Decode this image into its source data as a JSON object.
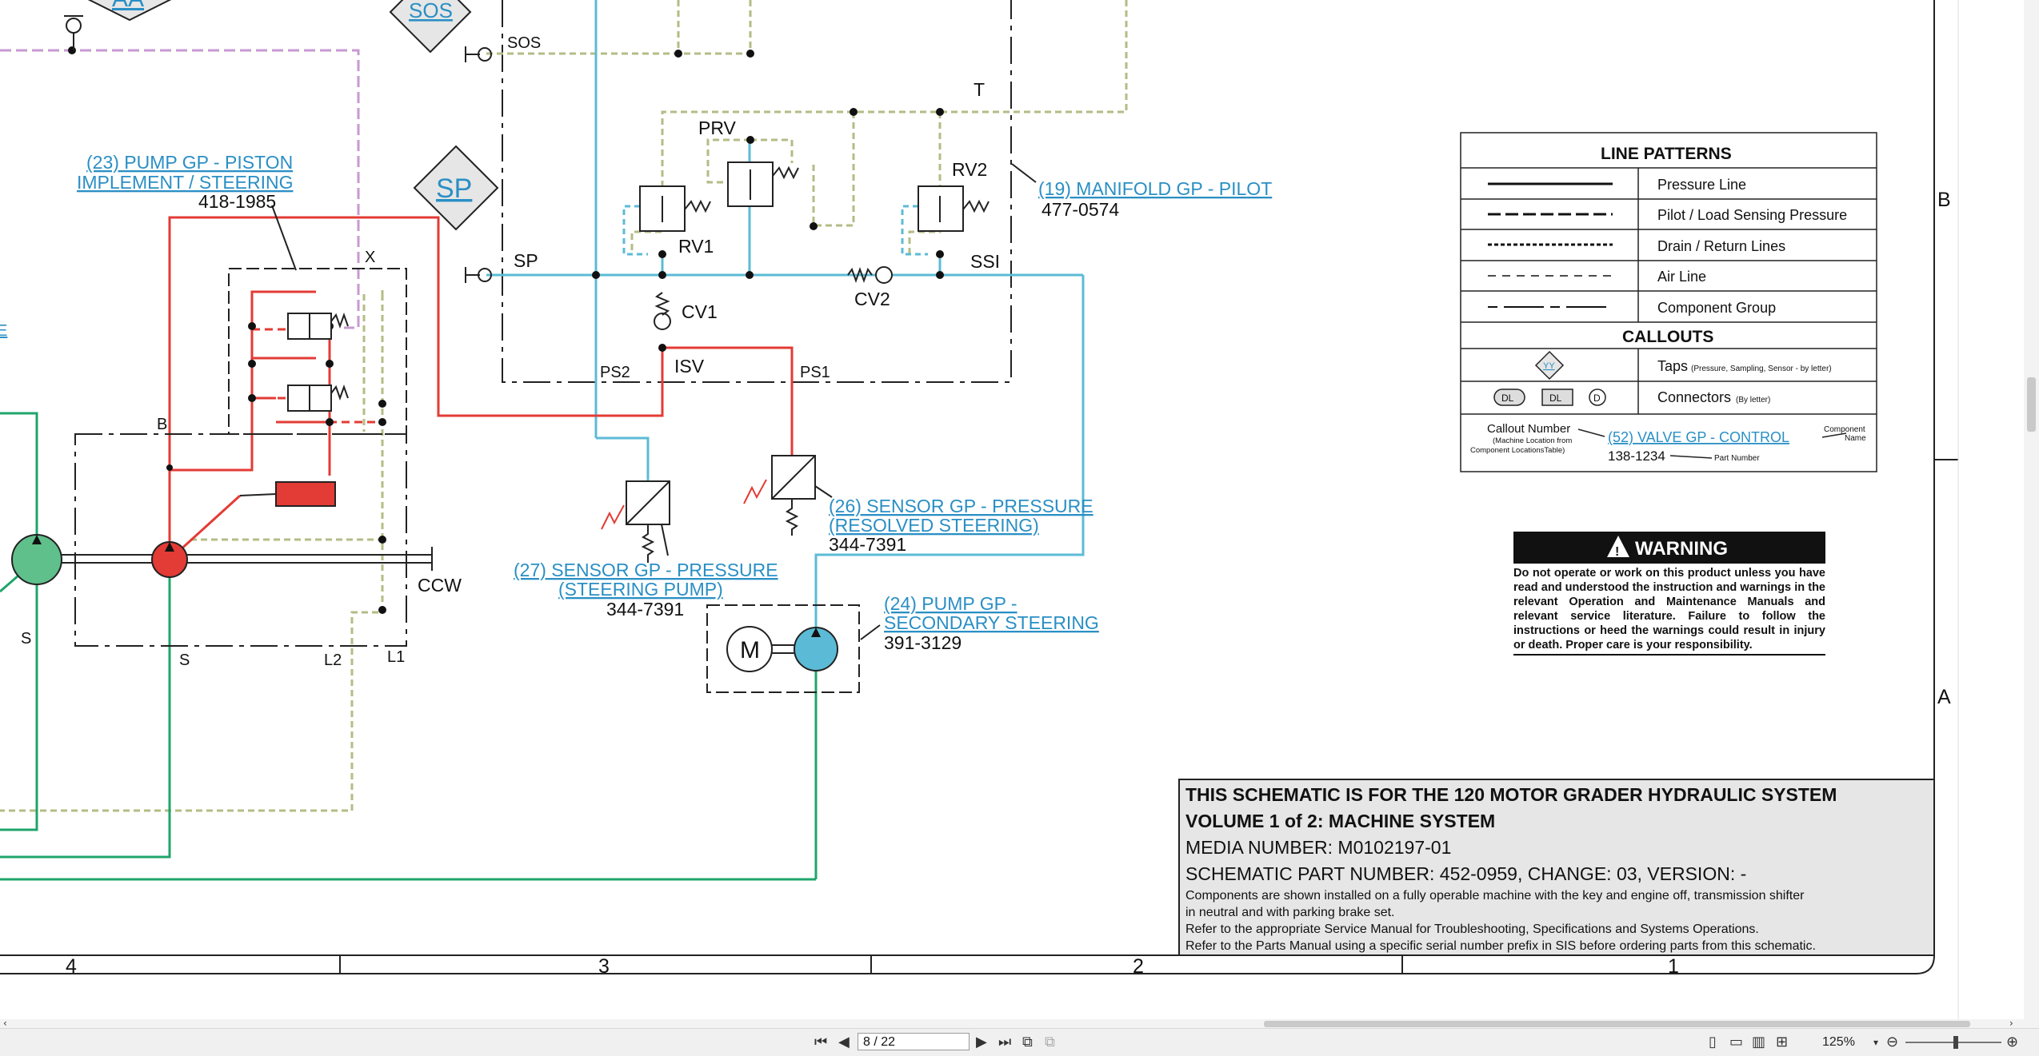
{
  "labels": {
    "aa": "AA",
    "sos_tap": "SOS",
    "sos": "SOS",
    "sp_tap": "SP",
    "sp": "SP",
    "t": "T",
    "prv": "PRV",
    "rv2": "RV2",
    "rv1": "RV1",
    "ssi": "SSI",
    "cv1": "CV1",
    "cv2": "CV2",
    "isv": "ISV",
    "ps2": "PS2",
    "ps1": "PS1",
    "x": "X",
    "b": "B",
    "ccw": "CCW",
    "s_left": "S",
    "s_mid": "S",
    "l2": "L2",
    "l1": "L1",
    "e_fragment": "E",
    "motor_m": "M"
  },
  "callouts": {
    "pump_piston": {
      "line1": "(23) PUMP GP - PISTON",
      "line2": "IMPLEMENT / STEERING",
      "part": "418-1985"
    },
    "manifold": {
      "line1": "(19) MANIFOLD GP - PILOT",
      "part": "477-0574"
    },
    "sensor26": {
      "line1": "(26) SENSOR GP - PRESSURE",
      "line2": "(RESOLVED STEERING)",
      "part": "344-7391"
    },
    "sensor27": {
      "line1": "(27) SENSOR GP - PRESSURE",
      "line2": "(STEERING PUMP)",
      "part": "344-7391"
    },
    "pump24": {
      "line1": "(24) PUMP GP -",
      "line2": "SECONDARY STEERING",
      "part": "391-3129"
    }
  },
  "legend": {
    "line_patterns_title": "LINE PATTERNS",
    "patterns": [
      "Pressure Line",
      "Pilot / Load Sensing Pressure",
      "Drain / Return Lines",
      "Air Line",
      "Component Group"
    ],
    "callouts_title": "CALLOUTS",
    "taps_label": "Taps",
    "taps_note": "(Pressure, Sampling, Sensor - by letter)",
    "taps_symbol": "YY",
    "connectors_label": "Connectors",
    "connectors_note": "(By letter)",
    "connector_symbols": [
      "DL",
      "DL",
      "D"
    ],
    "callout_number": "Callout Number",
    "callout_number_note1": "(Machine Location from",
    "callout_number_note2": "Component LocationsTable)",
    "example_callout": "(52) VALVE GP - CONTROL",
    "example_part": "138-1234",
    "component_name1": "Component",
    "component_name2": "Name",
    "part_number": "Part Number"
  },
  "warning": {
    "title": "WARNING",
    "text": "Do not operate or work on this product unless you have read and understood the instruction and warnings in the relevant Operation and Maintenance Manuals and relevant service literature. Failure to follow the instructions or heed the warnings could result in injury or death. Proper care is your responsibility."
  },
  "title_block": {
    "line1": "THIS SCHEMATIC IS FOR THE 120 MOTOR GRADER HYDRAULIC SYSTEM",
    "line2": "VOLUME 1 of 2: MACHINE SYSTEM",
    "line3": "MEDIA NUMBER: M0102197-01",
    "line4": "SCHEMATIC PART NUMBER: 452-0959, CHANGE: 03, VERSION: -",
    "note1": "Components are shown installed on a fully operable machine with the key and engine off, transmission shifter",
    "note2": "in neutral and with parking brake set.",
    "note3": "Refer to the appropriate Service Manual for Troubleshooting, Specifications and Systems Operations.",
    "note4": "Refer to the Parts Manual using a specific serial number prefix in SIS before ordering parts from this schematic."
  },
  "grid": {
    "columns": [
      "4",
      "3",
      "2",
      "1"
    ],
    "rows": [
      "B",
      "A"
    ]
  },
  "viewer": {
    "page": "8 / 22",
    "zoom": "125%"
  },
  "colors": {
    "pressure": "#e33b35",
    "supply": "#5bbbd6",
    "pilot": "#b4bc85",
    "drain_green": "#1fa56b",
    "air_purple": "#c79ad1",
    "link": "#2a8fc4"
  }
}
